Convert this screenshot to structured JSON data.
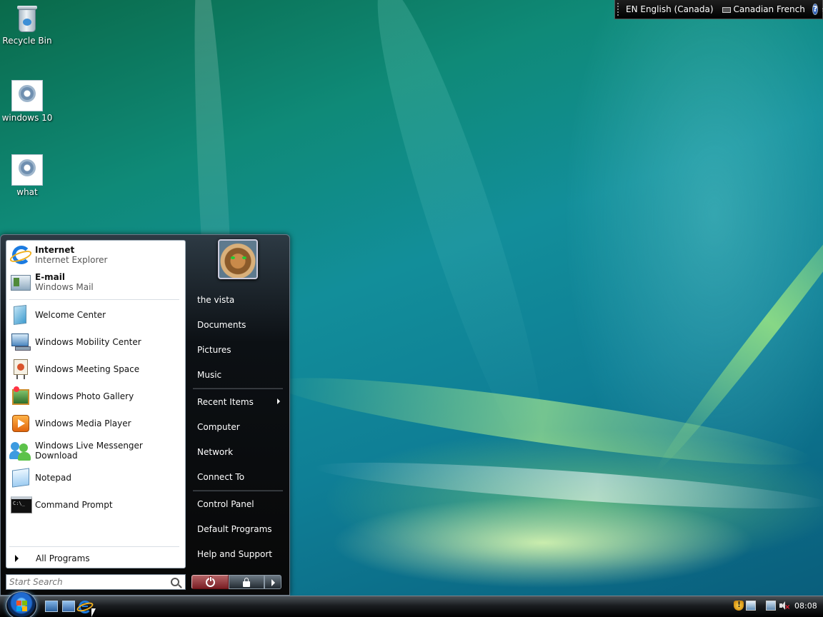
{
  "desktop": {
    "icons": [
      {
        "label": "Recycle Bin",
        "icon": "recycle-bin-icon"
      },
      {
        "label": "windows 10",
        "icon": "settings-file-icon"
      },
      {
        "label": "what",
        "icon": "settings-file-icon"
      }
    ]
  },
  "language_bar": {
    "input_language": "EN English (Canada)",
    "keyboard_layout": "Canadian French",
    "help": "?"
  },
  "start_menu": {
    "pinned": [
      {
        "title": "Internet",
        "subtitle": "Internet Explorer",
        "icon": "internet-explorer-icon"
      },
      {
        "title": "E-mail",
        "subtitle": "Windows Mail",
        "icon": "windows-mail-icon"
      }
    ],
    "recent": [
      {
        "label": "Welcome Center",
        "icon": "welcome-center-icon"
      },
      {
        "label": "Windows Mobility Center",
        "icon": "mobility-center-icon"
      },
      {
        "label": "Windows Meeting Space",
        "icon": "meeting-space-icon"
      },
      {
        "label": "Windows Photo Gallery",
        "icon": "photo-gallery-icon"
      },
      {
        "label": "Windows Media Player",
        "icon": "media-player-icon"
      },
      {
        "label": "Windows Live Messenger Download",
        "icon": "messenger-icon"
      },
      {
        "label": "Notepad",
        "icon": "notepad-icon"
      },
      {
        "label": "Command Prompt",
        "icon": "command-prompt-icon"
      }
    ],
    "all_programs": "All Programs",
    "search_placeholder": "Start Search",
    "right_items": [
      {
        "label": "the vista"
      },
      {
        "label": "Documents"
      },
      {
        "label": "Pictures"
      },
      {
        "label": "Music"
      },
      {
        "label": "Recent Items",
        "submenu": true
      },
      {
        "label": "Computer"
      },
      {
        "label": "Network"
      },
      {
        "label": "Connect To"
      },
      {
        "label": "Control Panel"
      },
      {
        "label": "Default Programs"
      },
      {
        "label": "Help and Support"
      }
    ]
  },
  "taskbar": {
    "clock": "08:08"
  },
  "colors": {
    "menu_dark": "#080808",
    "power_red": "#7a1e24",
    "accent_blue": "#1b7be0"
  }
}
